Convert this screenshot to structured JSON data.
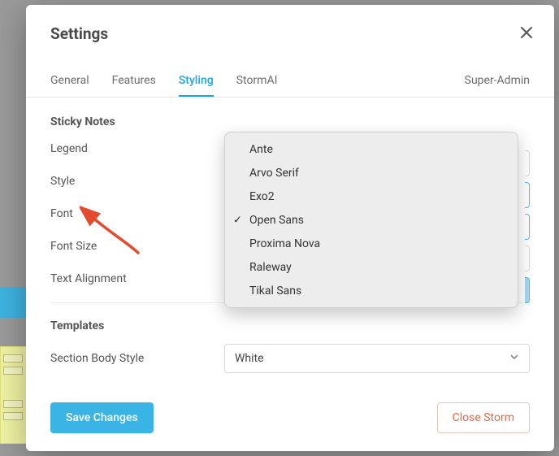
{
  "title": "Settings",
  "tabs": {
    "general": "General",
    "features": "Features",
    "styling": "Styling",
    "stormai": "StormAI",
    "superadmin": "Super-Admin",
    "active": "styling"
  },
  "sections": {
    "sticky": {
      "heading": "Sticky Notes",
      "rows": {
        "legend": "Legend",
        "style": "Style",
        "font": "Font",
        "fontsize": "Font Size",
        "textalign": "Text Alignment"
      }
    },
    "templates": {
      "heading": "Templates",
      "rows": {
        "sectionbody": "Section Body Style"
      },
      "sectionbody_value": "White"
    }
  },
  "font_menu": {
    "options": [
      "Ante",
      "Arvo Serif",
      "Exo2",
      "Open Sans",
      "Proxima Nova",
      "Raleway",
      "Tikal Sans"
    ],
    "selected": "Open Sans"
  },
  "footer": {
    "save": "Save Changes",
    "close": "Close Storm"
  }
}
